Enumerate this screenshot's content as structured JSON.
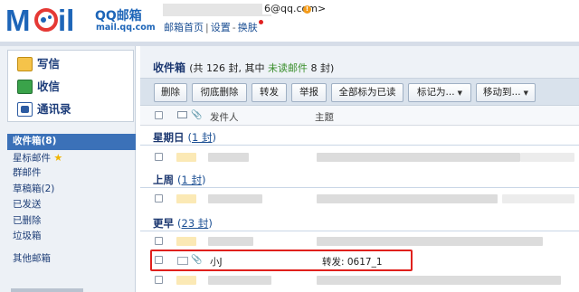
{
  "logo": {
    "brand": "QQ邮箱",
    "url": "mail.qq.com"
  },
  "header": {
    "email": "6@qq.com>",
    "status_badge": "!",
    "links": [
      "邮箱首页",
      "设置",
      "换肤"
    ],
    "separator": "|",
    "separator2": "-"
  },
  "sidebar": {
    "commands": [
      {
        "label": "写信",
        "icon": "pencil-icon"
      },
      {
        "label": "收信",
        "icon": "download-icon"
      },
      {
        "label": "通讯录",
        "icon": "contacts-icon"
      }
    ],
    "folders": [
      {
        "label": "收件箱(8)",
        "active": true
      },
      {
        "label": "星标邮件"
      },
      {
        "label": "群邮件"
      },
      {
        "label": "草稿箱(2)"
      },
      {
        "label": "已发送"
      },
      {
        "label": "已删除"
      },
      {
        "label": "垃圾箱"
      }
    ],
    "other": "其他邮箱"
  },
  "main": {
    "title": "收件箱",
    "title_prefix": "(共 126 封, 其中 ",
    "unread_label": "未读邮件",
    "title_suffix": " 8 封)",
    "toolbar": {
      "delete": "删除",
      "purge": "彻底删除",
      "forward": "转发",
      "report": "举报",
      "mark_all_read": "全部标为已读",
      "mark_as": "标记为...",
      "move_to": "移动到..."
    },
    "columns": {
      "sender": "发件人",
      "subject": "主题"
    },
    "groups": [
      {
        "title": "星期日",
        "count": "1 封"
      },
      {
        "title": "上周",
        "count": "1 封"
      },
      {
        "title": "更早",
        "count": "23 封"
      }
    ],
    "highlighted_mail": {
      "sender": "小J",
      "subject": "转发:  0617_1"
    }
  },
  "colors": {
    "accent": "#1d65b8",
    "active_folder": "#3b71b8",
    "highlight_border": "#e0201c",
    "unread": "#3a8f2c"
  }
}
